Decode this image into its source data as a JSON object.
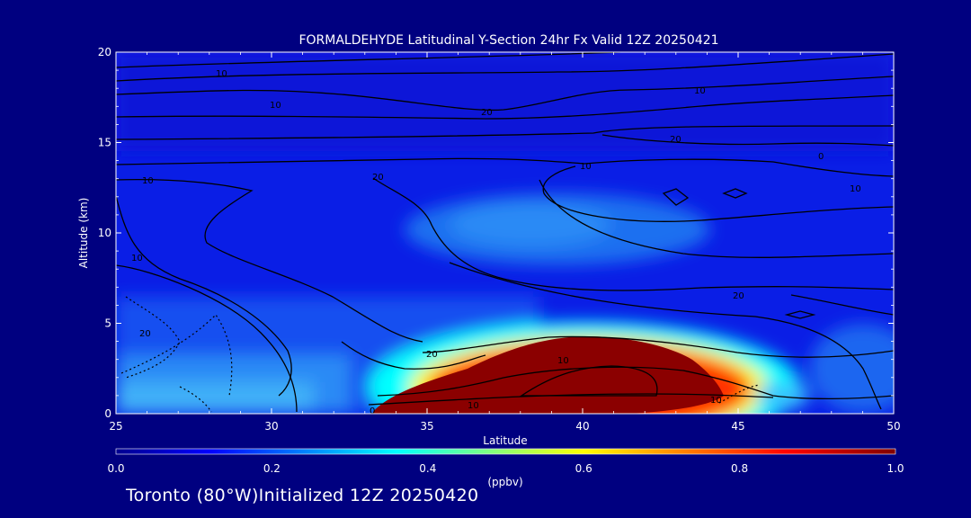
{
  "chart_data": {
    "type": "heatmap",
    "title": "FORMALDEHYDE Latitudinal Y-Section 24hr  Fx Valid 12Z 20250421",
    "xlabel": "Latitude",
    "ylabel": "Altitude (km)",
    "xlim": [
      25,
      50
    ],
    "ylim": [
      0,
      20
    ],
    "x_ticks": [
      25,
      30,
      35,
      40,
      45,
      50
    ],
    "y_ticks": [
      0,
      5,
      10,
      15,
      20
    ],
    "colorbar": {
      "label": "(ppbv)",
      "range": [
        0.0,
        1.0
      ],
      "ticks": [
        "0.0",
        "0.2",
        "0.4",
        "0.6",
        "0.8",
        "1.0"
      ]
    },
    "contour_labels": [
      "10",
      "10",
      "20",
      "10",
      "20",
      "10",
      "0",
      "10",
      "10",
      "20",
      "10",
      "20",
      "20",
      "20",
      "10",
      "10",
      "0",
      "10"
    ],
    "colors": {
      "background": "#000080",
      "low": "#0a1ee6",
      "high": "#8b0000"
    }
  },
  "footer": {
    "text": "Toronto (80°W)Initialized 12Z 20250420"
  }
}
